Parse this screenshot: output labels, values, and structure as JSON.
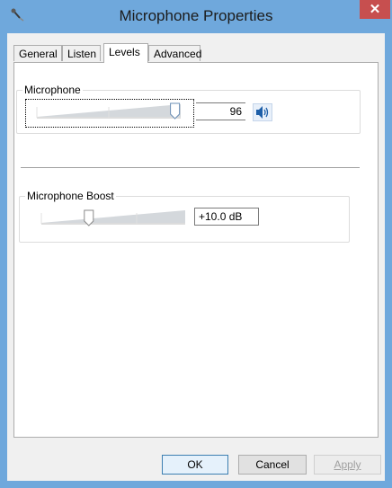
{
  "window": {
    "title": "Microphone Properties",
    "icon": "microphone-icon",
    "close_glyph": "✕",
    "accent_color": "#6fa8dc",
    "close_color": "#c74f4f"
  },
  "tabs": [
    {
      "label": "General",
      "active": false
    },
    {
      "label": "Listen",
      "active": false
    },
    {
      "label": "Levels",
      "active": true
    },
    {
      "label": "Advanced",
      "active": false
    }
  ],
  "levels": {
    "microphone": {
      "label": "Microphone",
      "value": "96",
      "level_fraction": 0.96,
      "speaker_icon": "speaker-icon"
    },
    "boost": {
      "label": "Microphone Boost",
      "value": "+10.0 dB",
      "level_fraction": 0.33
    }
  },
  "buttons": {
    "ok": "OK",
    "cancel": "Cancel",
    "apply": "Apply"
  }
}
